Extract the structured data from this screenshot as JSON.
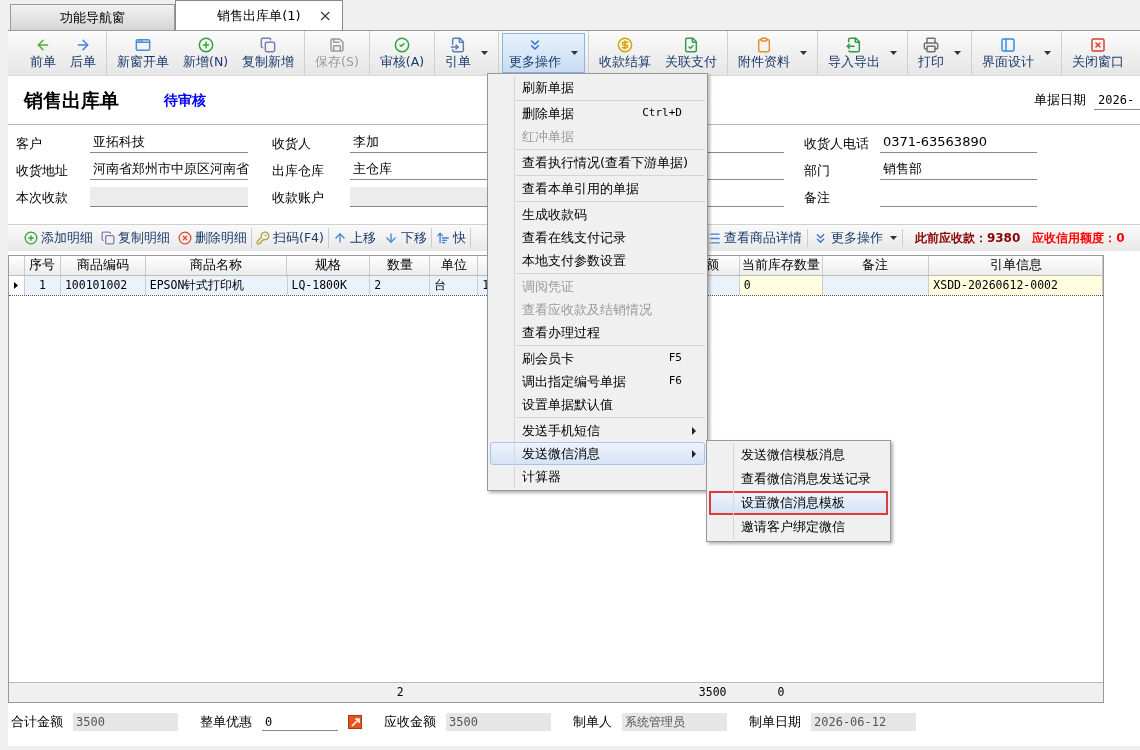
{
  "tabs": [
    {
      "label": "功能导航窗",
      "selected": false
    },
    {
      "label": "销售出库单(1)",
      "selected": true,
      "close": "×"
    }
  ],
  "toolbar": [
    [
      {
        "label": "前单",
        "kind": "back",
        "dropdown": false,
        "disabled": false,
        "active": false
      },
      {
        "label": "后单",
        "kind": "forward",
        "dropdown": false,
        "disabled": false,
        "active": false
      }
    ],
    [
      {
        "label": "新窗开单",
        "kind": "window",
        "dropdown": false,
        "disabled": false,
        "active": false
      },
      {
        "label": "新增(N)",
        "kind": "add",
        "dropdown": false,
        "disabled": false,
        "active": false
      },
      {
        "label": "复制新增",
        "kind": "copy",
        "dropdown": false,
        "disabled": false,
        "active": false
      }
    ],
    [
      {
        "label": "保存(S)",
        "kind": "save",
        "dropdown": false,
        "disabled": true,
        "active": false
      }
    ],
    [
      {
        "label": "审核(A)",
        "kind": "check",
        "dropdown": false,
        "disabled": false,
        "active": false
      }
    ],
    [
      {
        "label": "引单",
        "kind": "import",
        "dropdown": true,
        "disabled": false,
        "active": false
      }
    ],
    [
      {
        "label": "更多操作",
        "kind": "more",
        "dropdown": true,
        "disabled": false,
        "active": true
      }
    ],
    [
      {
        "label": "收款结算",
        "kind": "coin",
        "dropdown": false,
        "disabled": false,
        "active": false
      },
      {
        "label": "关联支付",
        "kind": "filecheck",
        "dropdown": false,
        "disabled": false,
        "active": false
      }
    ],
    [
      {
        "label": "附件资料",
        "kind": "clipboard",
        "dropdown": true,
        "disabled": false,
        "active": false
      }
    ],
    [
      {
        "label": "导入导出",
        "kind": "export",
        "dropdown": true,
        "disabled": false,
        "active": false
      }
    ],
    [
      {
        "label": "打印",
        "kind": "print",
        "dropdown": true,
        "disabled": false,
        "active": false
      }
    ],
    [
      {
        "label": "界面设计",
        "kind": "layout",
        "dropdown": true,
        "disabled": false,
        "active": false
      }
    ],
    [
      {
        "label": "关闭窗口",
        "kind": "close",
        "dropdown": false,
        "disabled": false,
        "active": false
      }
    ]
  ],
  "header": {
    "title": "销售出库单",
    "status": "待审核",
    "date_label": "单据日期",
    "date_value": "2026-"
  },
  "form": {
    "rows": [
      [
        {
          "label": "客户",
          "value": "亚拓科技",
          "disabled": false
        },
        {
          "label": "收货人",
          "value": "李加",
          "disabled": false
        },
        {
          "disabled": false
        },
        {
          "label": "收货人电话",
          "value": "0371-63563890",
          "disabled": false
        }
      ],
      [
        {
          "label": "收货地址",
          "value": "河南省郑州市中原区河南省",
          "disabled": false
        },
        {
          "label": "出库仓库",
          "value": "主仓库",
          "disabled": false
        },
        {
          "disabled": false
        },
        {
          "label": "部门",
          "value": "销售部",
          "disabled": false
        }
      ],
      [
        {
          "label": "本次收款",
          "disabled": true
        },
        {
          "label": "收款账户",
          "disabled": true
        },
        {
          "disabled": false
        },
        {
          "label": "备注",
          "disabled": false
        }
      ]
    ]
  },
  "detail_toolbar": {
    "groups": [
      [
        {
          "label": "添加明细",
          "kind": "add"
        },
        {
          "label": "复制明细",
          "kind": "copy"
        },
        {
          "label": "删除明细",
          "kind": "delete"
        }
      ],
      [
        {
          "label": "扫码(F4)",
          "kind": "key"
        }
      ],
      [
        {
          "label": "上移",
          "kind": "up"
        },
        {
          "label": "下移",
          "kind": "down"
        }
      ],
      [
        {
          "label": "快",
          "kind": "sort"
        }
      ]
    ],
    "right": [
      {
        "label": "查看商品详情",
        "kind": "list",
        "dropdown": false
      },
      {
        "label": "更多操作",
        "kind": "more",
        "dropdown": true
      }
    ],
    "notes": [
      {
        "text": "此前应收款：9380",
        "color": "#8b0000"
      },
      {
        "text": "应收信用额度：0",
        "color": "#ff0000"
      }
    ]
  },
  "table": {
    "columns": [
      {
        "header": "序号",
        "readonly": false
      },
      {
        "header": "商品编码",
        "readonly": false
      },
      {
        "header": "商品名称",
        "readonly": false
      },
      {
        "header": "规格",
        "readonly": false
      },
      {
        "header": "数量",
        "readonly": false,
        "total": "2"
      },
      {
        "header": "单位",
        "readonly": false
      },
      {
        "readonly": false
      },
      {
        "header": "额",
        "readonly": false,
        "total": "3500"
      },
      {
        "header": "当前库存数量",
        "readonly": true,
        "total": "0"
      },
      {
        "header": "备注",
        "readonly": false
      },
      {
        "header": "引单信息",
        "readonly": true
      }
    ],
    "rows": [
      {
        "selected": true,
        "cells": [
          "1",
          "100101002",
          "EPSON针式打印机",
          "LQ-1800K",
          "2",
          "台",
          "1",
          null,
          "0",
          null,
          "XSDD-20260612-0002"
        ]
      }
    ]
  },
  "footer": [
    {
      "label": "合计金额",
      "value": "3500",
      "kind": "readonly"
    },
    {
      "label": "整单优惠",
      "value": "0",
      "kind": "editable",
      "button": true
    },
    {
      "label": "应收金额",
      "value": "3500",
      "kind": "readonly"
    },
    {
      "label": "制单人",
      "value": "系统管理员",
      "kind": "readonly"
    },
    {
      "label": "制单日期",
      "value": "2026-06-12",
      "kind": "readonly"
    }
  ],
  "menu": {
    "groups": [
      [
        {
          "label": "刷新单据",
          "disabled": false,
          "submenu": false,
          "selected": false
        }
      ],
      [
        {
          "label": "删除单据",
          "shortcut": "Ctrl+D",
          "disabled": false,
          "submenu": false,
          "selected": false
        },
        {
          "label": "红冲单据",
          "disabled": true,
          "submenu": false,
          "selected": false
        }
      ],
      [
        {
          "label": "查看执行情况(查看下游单据)",
          "disabled": false,
          "submenu": false,
          "selected": false
        }
      ],
      [
        {
          "label": "查看本单引用的单据",
          "disabled": false,
          "submenu": false,
          "selected": false
        }
      ],
      [
        {
          "label": "生成收款码",
          "disabled": false,
          "submenu": false,
          "selected": false
        },
        {
          "label": "查看在线支付记录",
          "disabled": false,
          "submenu": false,
          "selected": false
        },
        {
          "label": "本地支付参数设置",
          "disabled": false,
          "submenu": false,
          "selected": false
        }
      ],
      [
        {
          "label": "调阅凭证",
          "disabled": true,
          "submenu": false,
          "selected": false
        },
        {
          "label": "查看应收款及结销情况",
          "disabled": true,
          "submenu": false,
          "selected": false
        },
        {
          "label": "查看办理过程",
          "disabled": false,
          "submenu": false,
          "selected": false
        }
      ],
      [
        {
          "label": "刷会员卡",
          "shortcut": "F5",
          "disabled": false,
          "submenu": false,
          "selected": false
        },
        {
          "label": "调出指定编号单据",
          "shortcut": "F6",
          "disabled": false,
          "submenu": false,
          "selected": false
        },
        {
          "label": "设置单据默认值",
          "disabled": false,
          "submenu": false,
          "selected": false
        }
      ],
      [
        {
          "label": "发送手机短信",
          "disabled": false,
          "submenu": true,
          "selected": false
        },
        {
          "label": "发送微信消息",
          "disabled": false,
          "submenu": true,
          "selected": true
        },
        {
          "label": "计算器",
          "disabled": false,
          "submenu": false,
          "selected": false
        }
      ]
    ]
  },
  "submenu": {
    "items": [
      {
        "label": "发送微信模板消息",
        "selected": false
      },
      {
        "label": "查看微信消息发送记录",
        "selected": false
      },
      {
        "label": "设置微信消息模板",
        "selected": true
      },
      {
        "label": "邀请客户绑定微信",
        "selected": false
      }
    ]
  }
}
